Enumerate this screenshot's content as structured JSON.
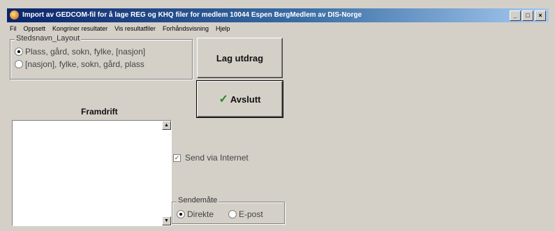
{
  "window": {
    "title": "Import av GEDCOM-fil for å lage REG og KHQ filer for medlem 10044 Espen BergMedlem av DIS-Norge",
    "minimize": "_",
    "maximize": "□",
    "close": "×"
  },
  "menu": [
    "Fil",
    "Oppsett",
    "Kongriner resultater",
    "Vis resultatfiler",
    "Forhåndsvisning",
    "Hjelp"
  ],
  "layout_group": {
    "legend": "Stedsnavn_Layout",
    "options": [
      {
        "label": "Plass, gård, sokn, fylke, [nasjon]",
        "checked": true
      },
      {
        "label": "[nasjon], fylke, sokn, gård, plass",
        "checked": false
      }
    ]
  },
  "buttons": {
    "lag_utdrag": "Lag utdrag",
    "avslutt": "Avslutt",
    "avslutt_icon": "✓"
  },
  "progress": {
    "label": "Framdrift"
  },
  "send_internet": {
    "label": "Send via Internet",
    "checked": true,
    "mark": "✓"
  },
  "send_method": {
    "legend": "Sendemåte",
    "options": [
      {
        "label": "Direkte",
        "checked": true
      },
      {
        "label": "E-post",
        "checked": false
      }
    ]
  },
  "icons": {
    "app": "app-icon",
    "scroll_up": "▲",
    "scroll_down": "▼"
  }
}
